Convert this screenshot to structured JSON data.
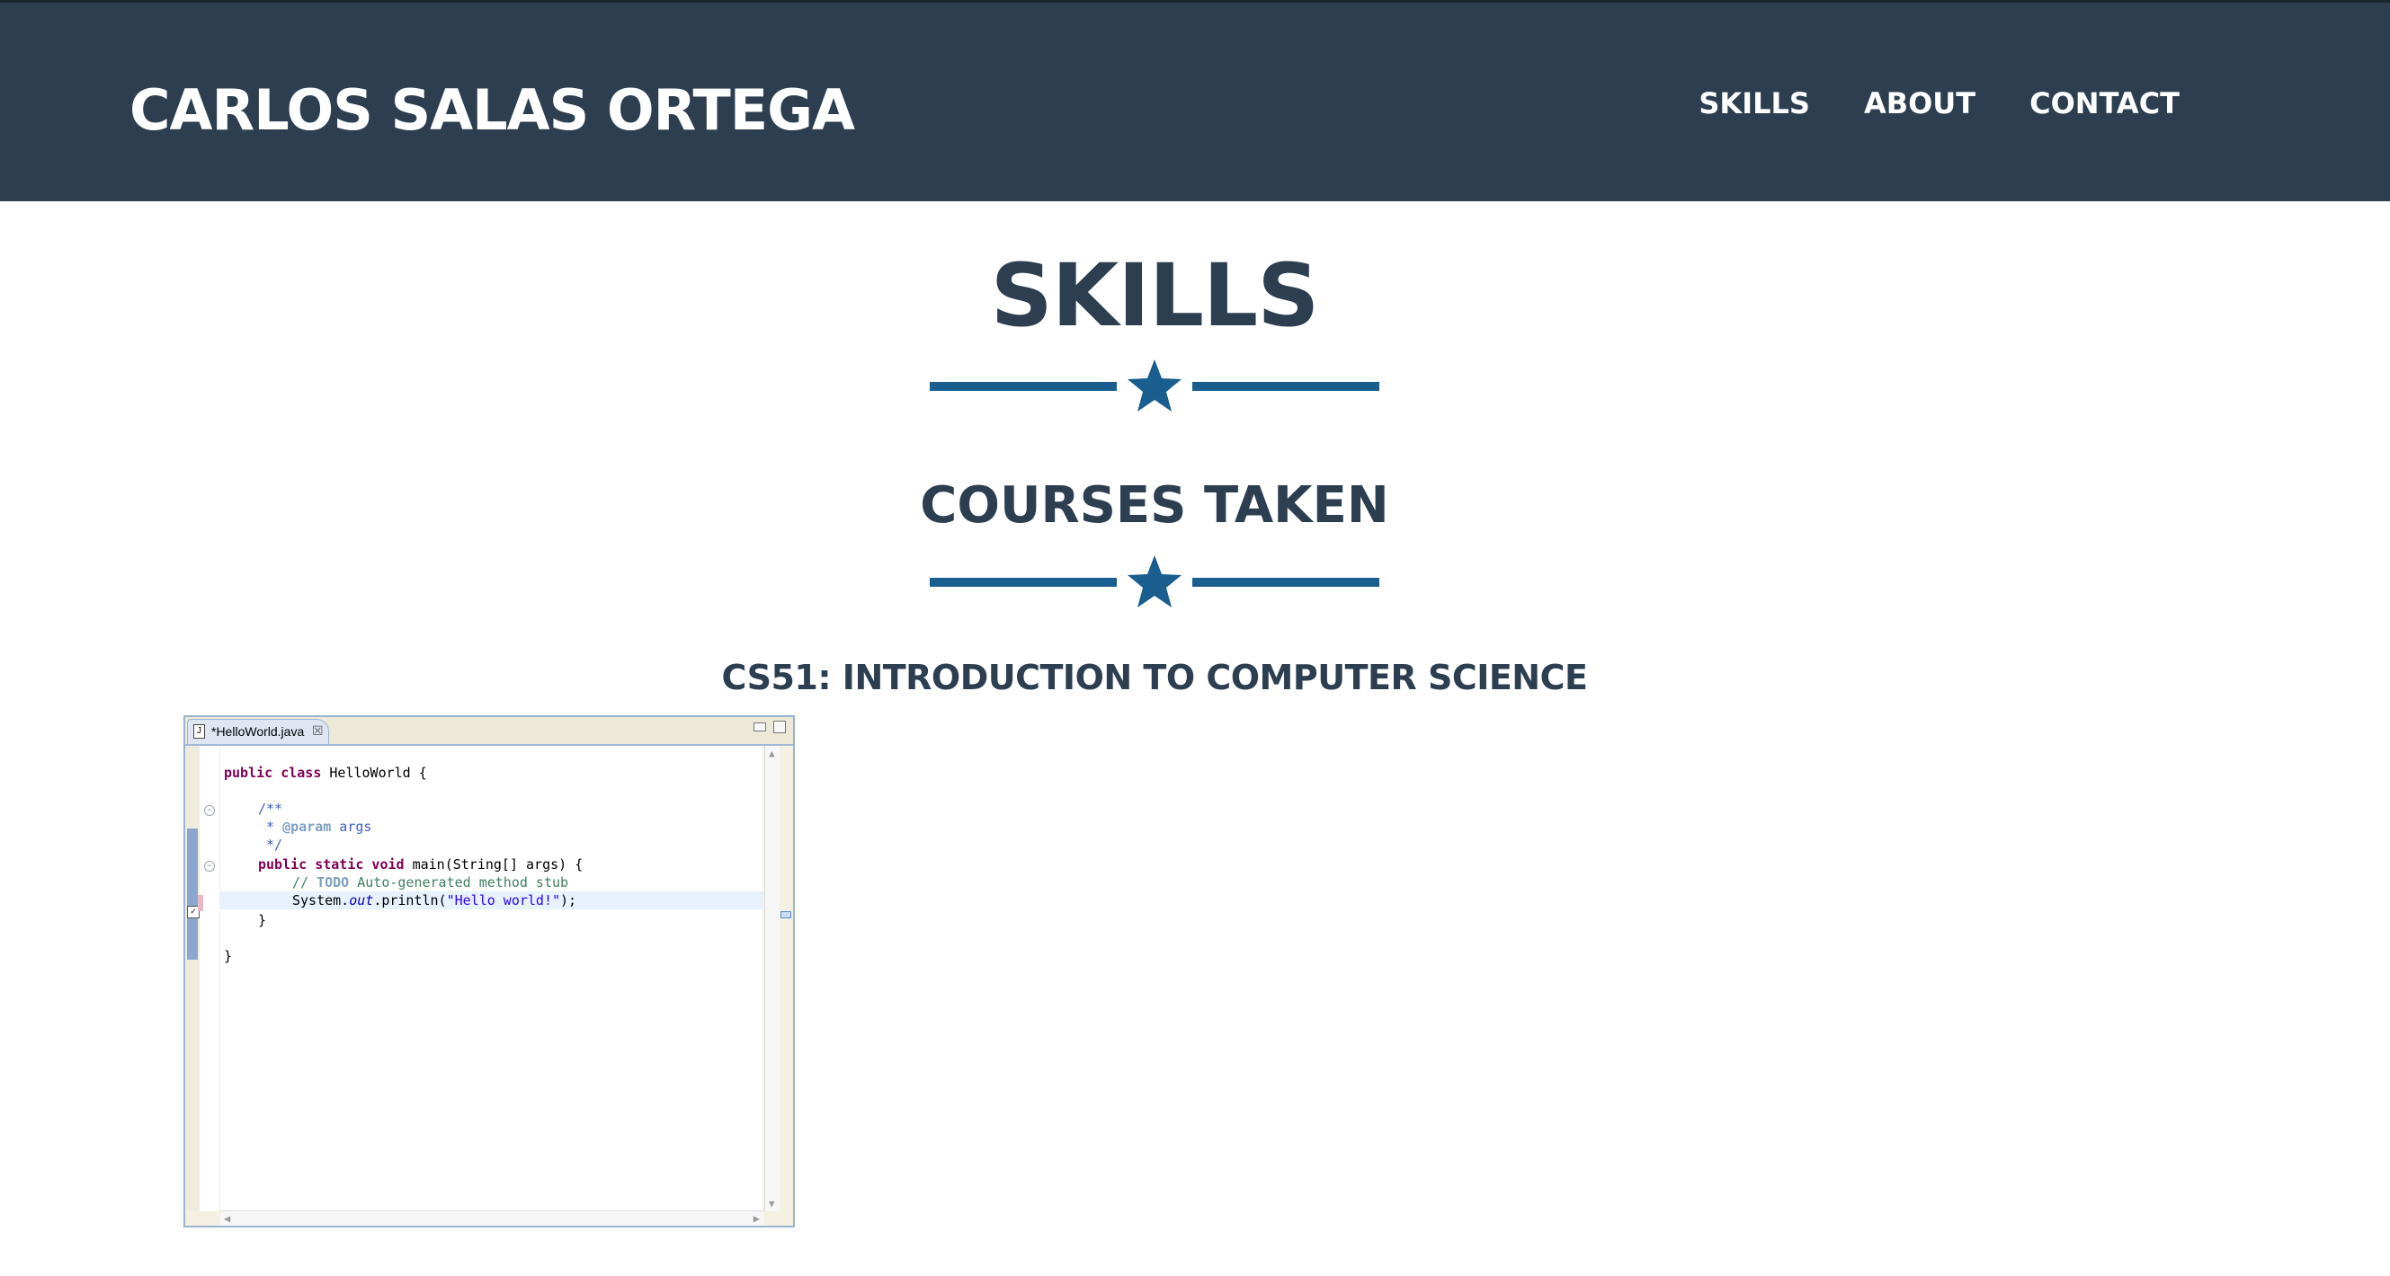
{
  "navbar": {
    "brand": "CARLOS SALAS ORTEGA",
    "links": [
      {
        "label": "SKILLS"
      },
      {
        "label": "ABOUT"
      },
      {
        "label": "CONTACT"
      }
    ],
    "background": "#2c3e50"
  },
  "skills_section": {
    "title": "SKILLS",
    "subtitle": "COURSES TAKEN",
    "course_title": "CS51: INTRODUCTION TO COMPUTER SCIENCE",
    "divider_icon": "star-icon",
    "accent_color": "#1a5d8f"
  },
  "editor": {
    "tab_label": "*HelloWorld.java",
    "tab_close_icon": "close-icon",
    "code": {
      "l1_kw": "public class",
      "l1_rest": " HelloWorld {",
      "l2": "/**",
      "l3_pre": " * ",
      "l3_tag": "@param",
      "l3_rest": " args",
      "l4": " */",
      "l5_kw": "public static void",
      "l5_rest": " main(String[] args) {",
      "l6_pre": "// ",
      "l6_todo": "TODO",
      "l6_rest": " Auto-generated method stub",
      "l7_pre": "System.",
      "l7_field": "out",
      "l7_mid": ".println(",
      "l7_str": "\"Hello world!\"",
      "l7_end": ");",
      "l8": "}",
      "l9": "}"
    }
  }
}
